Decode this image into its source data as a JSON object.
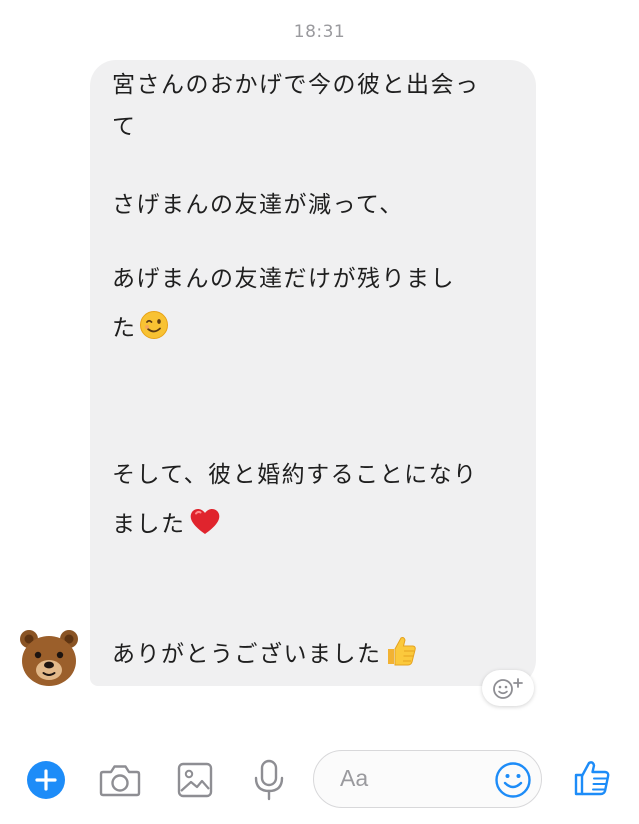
{
  "chat": {
    "timestamp": "18:31",
    "message_lines": [
      "宮さんのおかげで今の彼と出会っ",
      "て",
      "さげまんの友達が減って、",
      "あげまんの友達だけが残りまし",
      "た",
      "そして、彼と婚約することになり",
      "ました",
      "ありがとうございました"
    ],
    "emojis": [
      "winking-face",
      "red-heart",
      "thumbs-up"
    ],
    "sender_avatar": "bear-face"
  },
  "composer": {
    "placeholder": "Aa",
    "tools": [
      "plus-icon",
      "camera-icon",
      "image-icon",
      "microphone-icon",
      "emoji-icon",
      "like-icon"
    ]
  },
  "colors": {
    "accent": "#1d8cf8",
    "bubble": "#f0f0f1",
    "timestamp": "#9a9a9e"
  }
}
